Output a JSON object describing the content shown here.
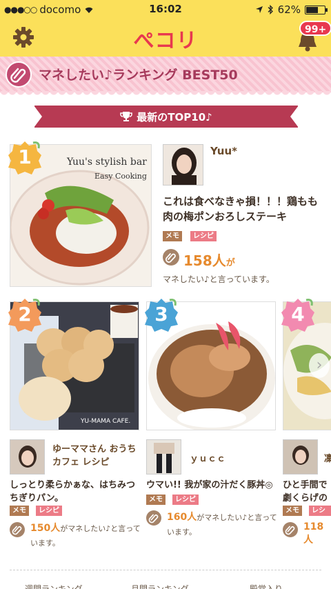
{
  "status": {
    "carrier": "docomo",
    "time": "16:02",
    "battery": "62%"
  },
  "app": {
    "logo": "ぺコリ",
    "notifications": "99+"
  },
  "ranking": {
    "title": "マネしたい♪ランキング BEST50",
    "top10_label": "最新のTOP10♪"
  },
  "tags": {
    "memo": "メモ",
    "recipe": "レシピ"
  },
  "featured": {
    "rank": "1",
    "photo_caption": "Yuu's stylish bar",
    "photo_subcaption": "Easy Cooking",
    "user": "Yuu*",
    "title": "これは食べなきゃ損！！！鶏もも肉の梅ポンおろしステーキ",
    "count": "158人",
    "count_suffix": "が",
    "says": "マネしたい♪と言っています。"
  },
  "cards": [
    {
      "rank": "2",
      "user": "ゆーママさん おうちカフェ レシピ",
      "title": "しっとり柔らかぁな、はちみつちぎりパン。",
      "count": "150人",
      "says": "がマネしたい♪と言っています。",
      "watermark": "YU-MAMA CAFE."
    },
    {
      "rank": "3",
      "user": "ｙｕｃｃ",
      "title": "ウマい!! 我が家の汁だく豚丼◎",
      "count": "160人",
      "says": "がマネしたい♪と言っています。"
    },
    {
      "rank": "4",
      "user": "凜",
      "title": "ひと手間で劇くらげのサラ",
      "count": "118人",
      "says": ""
    }
  ],
  "bottom_tabs": [
    "週間ランキング",
    "月間ランキング",
    "殿堂入り"
  ],
  "colors": {
    "brand_yellow": "#fbe05a",
    "brand_red": "#e8384f",
    "ribbon": "#b73a53"
  }
}
